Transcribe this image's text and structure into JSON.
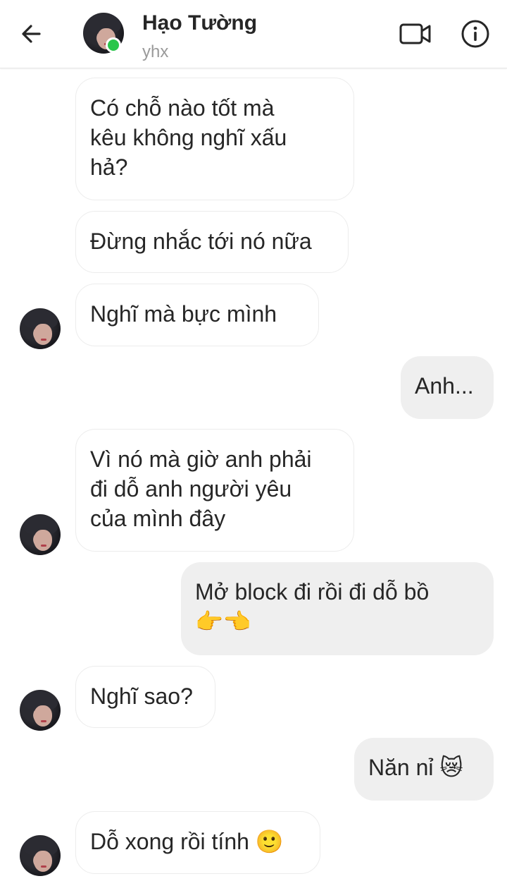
{
  "header": {
    "name": "Hạo Tường",
    "subtitle": "yhx"
  },
  "messages": [
    {
      "side": "in",
      "text": "Có chỗ nào tốt mà\nkêu không nghĩ xấu\nhả?"
    },
    {
      "side": "in",
      "text": "Đừng nhắc tới nó nữa"
    },
    {
      "side": "in",
      "text": "Nghĩ mà bực mình"
    },
    {
      "side": "out",
      "text": "Anh..."
    },
    {
      "side": "in",
      "text": "Vì nó mà giờ anh phải\nđi dỗ anh người yêu\ncủa mình đây"
    },
    {
      "side": "out",
      "text": "Mở block đi rồi đi dỗ bồ",
      "emoji": "👉👈"
    },
    {
      "side": "in",
      "text": "Nghĩ sao?"
    },
    {
      "side": "out",
      "text": "Năn nỉ",
      "emoji": "😿"
    },
    {
      "side": "in",
      "text": "Dỗ xong rồi tính",
      "emoji": "🙂"
    }
  ],
  "icons": {
    "back": "arrow-left-icon",
    "video": "video-camera-icon",
    "info": "info-icon"
  },
  "colors": {
    "online": "#2ac64b",
    "outgoing_bubble": "#efefef",
    "incoming_border": "#ececec"
  }
}
